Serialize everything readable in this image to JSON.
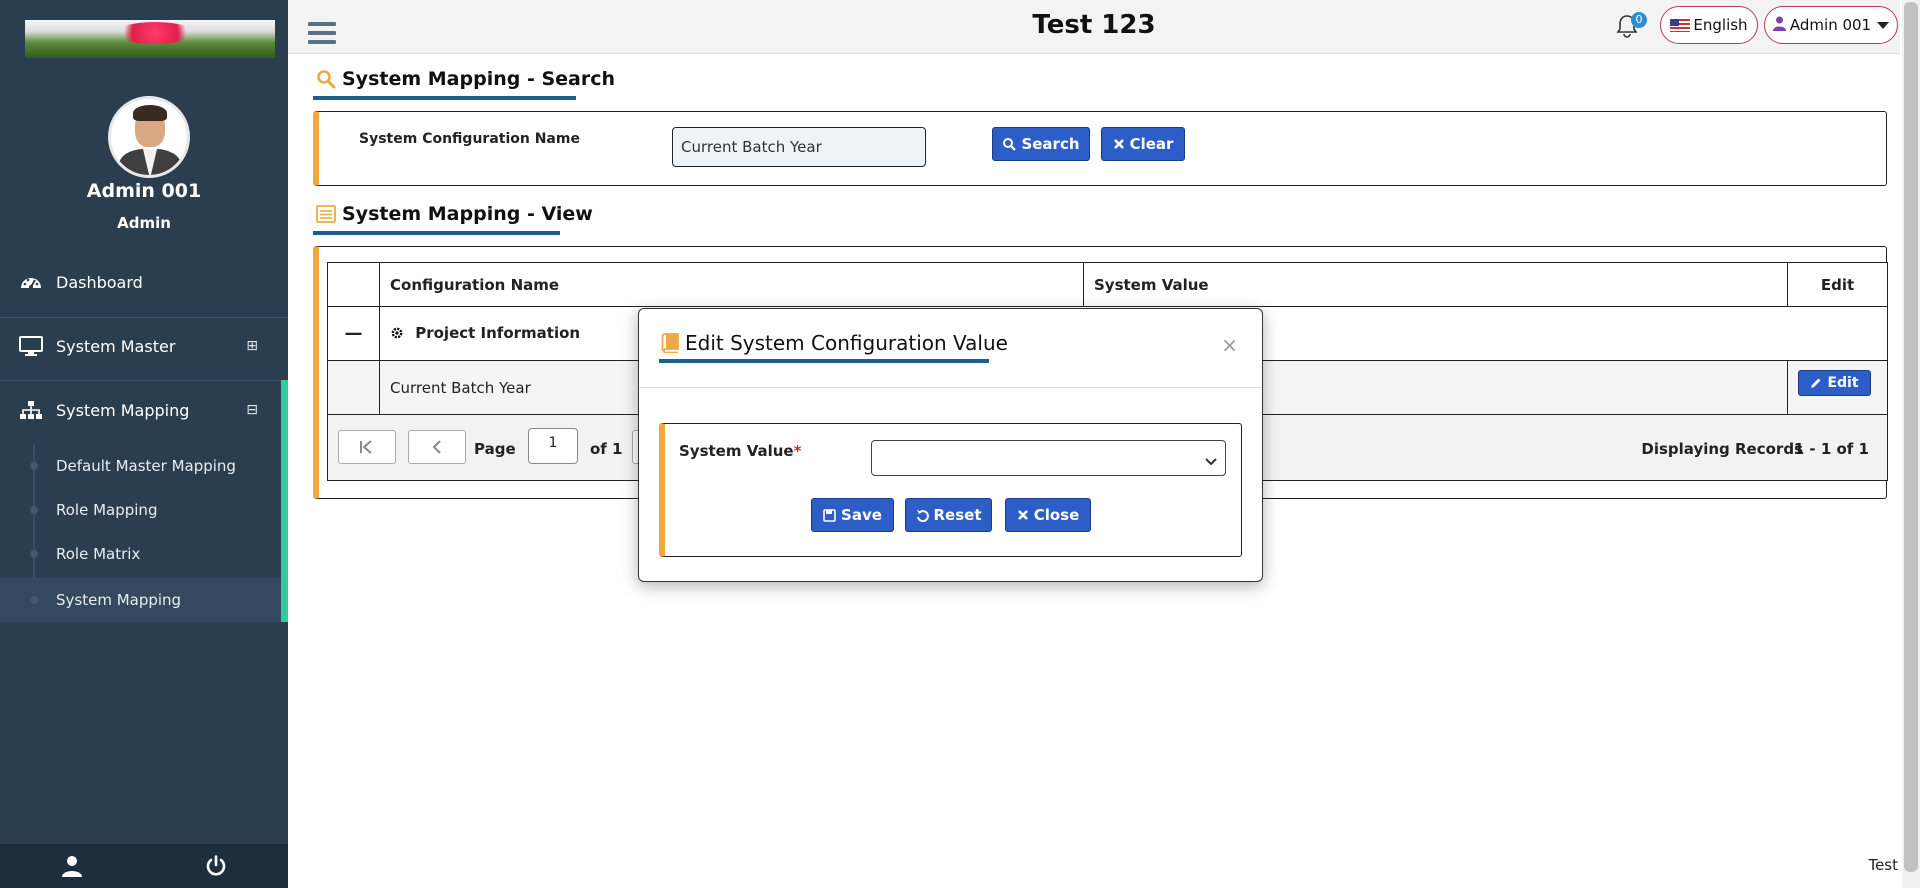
{
  "app_title": "Test 123",
  "footer_text": "Test",
  "user": {
    "name": "Admin 001",
    "role": "Admin"
  },
  "topbar": {
    "notification_count": "0",
    "language": "English",
    "user_menu": "Admin 001"
  },
  "sidebar": {
    "items": [
      {
        "label": "Dashboard",
        "icon": "dashboard-icon"
      },
      {
        "label": "System Master",
        "icon": "monitor-icon",
        "expander": "⊞"
      },
      {
        "label": "System Mapping",
        "icon": "sitemap-icon",
        "expander": "⊟"
      }
    ],
    "subitems": [
      {
        "label": "Default Master Mapping"
      },
      {
        "label": "Role Mapping"
      },
      {
        "label": "Role Matrix"
      },
      {
        "label": "System Mapping"
      }
    ]
  },
  "search_section": {
    "title": "System Mapping - Search",
    "field_label": "System Configuration Name",
    "field_value": "Current Batch Year",
    "search_label": "Search",
    "clear_label": "Clear"
  },
  "view_section": {
    "title": "System Mapping - View",
    "columns": [
      "Configuration Name",
      "System Value",
      "Edit"
    ],
    "group_row": "Project Information",
    "collapse_symbol": "—",
    "rows": [
      {
        "name": "Current Batch Year",
        "value": "",
        "edit_label": "Edit"
      }
    ],
    "pager": {
      "page_label": "Page",
      "page_value": "1",
      "of_label": "of 1",
      "displaying": "Displaying Records",
      "range": "1 - 1 of 1"
    }
  },
  "modal": {
    "title": "Edit System Configuration Value",
    "close_symbol": "×",
    "field_label": "System Value",
    "required_mark": "*",
    "select_value": "",
    "save_label": "Save",
    "reset_label": "Reset",
    "close_label": "Close"
  },
  "colors": {
    "sidebar": "#2b3e50",
    "accent_button": "#2d5ec8",
    "panel_border": "#f0a940",
    "underline": "#1f5f8b",
    "active_bar": "#2ecc9a"
  }
}
